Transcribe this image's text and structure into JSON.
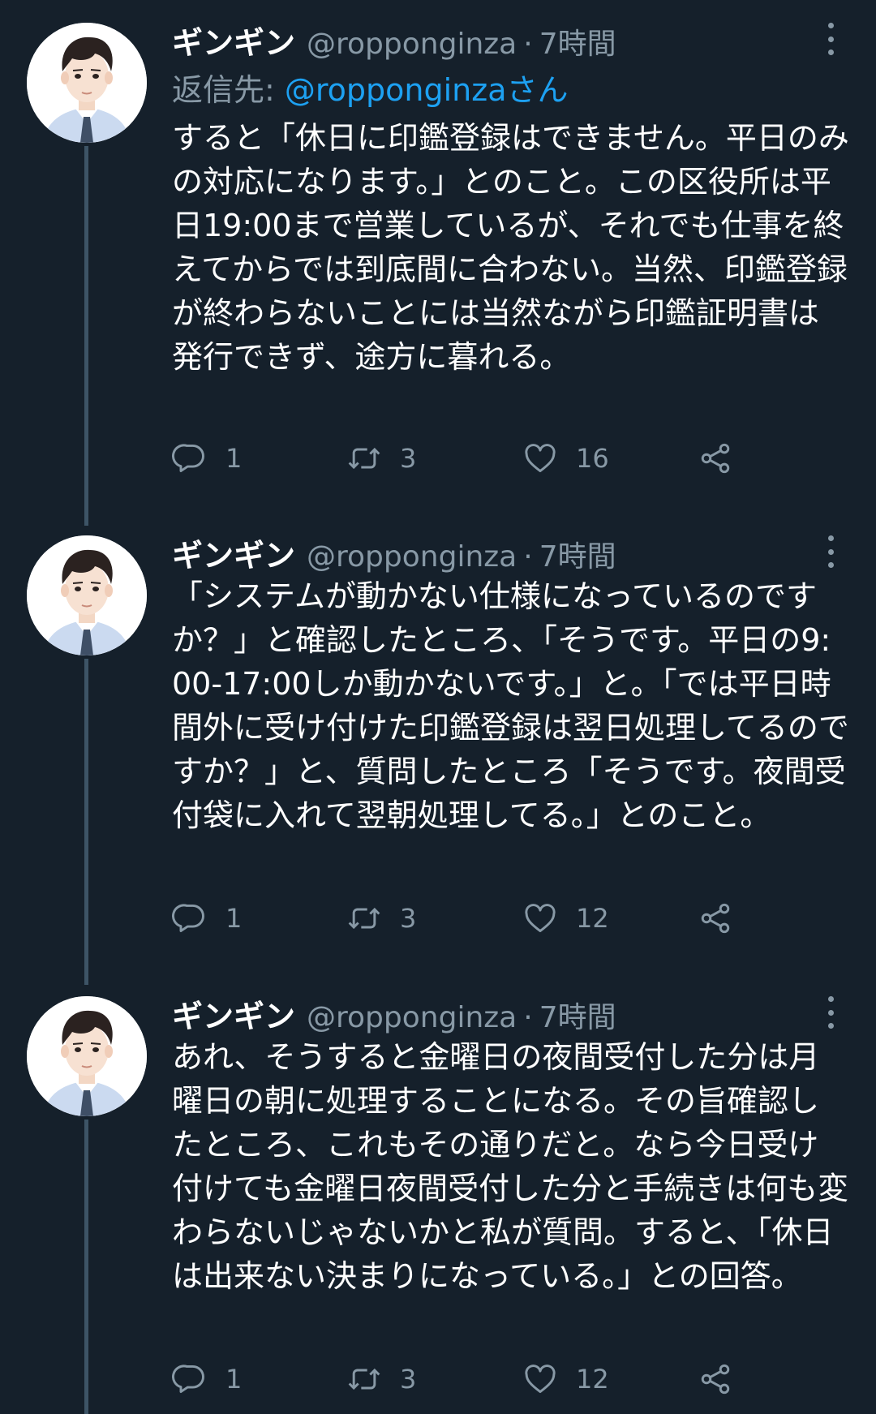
{
  "tweets": [
    {
      "name": "ギンギン",
      "handle": "@ropponginza",
      "dot": "·",
      "time": "7時間",
      "reply_prefix": "返信先: ",
      "reply_mention": "@ropponginzaさん",
      "text": "すると「休日に印鑑登録はできません。平日のみの対応になります。」とのこと。この区役所は平日19:00まで営業しているが、それでも仕事を終えてからでは到底間に合わない。当然、印鑑登録が終わらないことには当然ながら印鑑証明書は発行できず、途方に暮れる。",
      "replies": "1",
      "retweets": "3",
      "likes": "16"
    },
    {
      "name": "ギンギン",
      "handle": "@ropponginza",
      "dot": "·",
      "time": "7時間",
      "text": "「システムが動かない仕様になっているのですか？」と確認したところ、「そうです。平日の9:00-17:00しか動かないです。」と。「では平日時間外に受け付けた印鑑登録は翌日処理してるのですか？」と、質問したところ「そうです。夜間受付袋に入れて翌朝処理してる。」とのこと。",
      "replies": "1",
      "retweets": "3",
      "likes": "12"
    },
    {
      "name": "ギンギン",
      "handle": "@ropponginza",
      "dot": "·",
      "time": "7時間",
      "text": "あれ、そうすると金曜日の夜間受付した分は月曜日の朝に処理することになる。その旨確認したところ、これもその通りだと。なら今日受け付けても金曜日夜間受付した分と手続きは何も変わらないじゃないかと私が質問。すると、「休日は出来ない決まりになっている。」との回答。",
      "replies": "1",
      "retweets": "3",
      "likes": "12"
    }
  ],
  "icons": {
    "reply": "reply-icon",
    "retweet": "retweet-icon",
    "like": "heart-icon",
    "share": "share-icon",
    "more": "more-vertical-icon",
    "avatar": "avatar"
  },
  "colors": {
    "background": "#15202b",
    "text": "#ffffff",
    "secondary": "#8899a6",
    "link": "#1da1f2",
    "thread_line": "#3d5466"
  }
}
